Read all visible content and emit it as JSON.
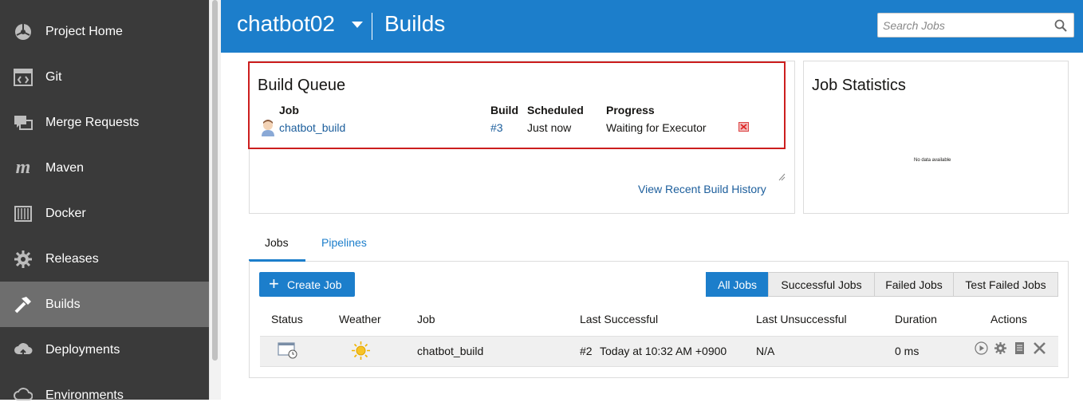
{
  "sidebar": {
    "items": [
      {
        "label": "Project Home",
        "icon": "project-home-icon"
      },
      {
        "label": "Git",
        "icon": "git-icon"
      },
      {
        "label": "Merge Requests",
        "icon": "merge-requests-icon"
      },
      {
        "label": "Maven",
        "icon": "maven-icon"
      },
      {
        "label": "Docker",
        "icon": "docker-icon"
      },
      {
        "label": "Releases",
        "icon": "releases-icon"
      },
      {
        "label": "Builds",
        "icon": "builds-icon",
        "active": true
      },
      {
        "label": "Deployments",
        "icon": "deployments-icon"
      },
      {
        "label": "Environments",
        "icon": "environments-icon"
      }
    ]
  },
  "header": {
    "project": "chatbot02",
    "title": "Builds",
    "search_placeholder": "Search Jobs"
  },
  "build_queue": {
    "title": "Build Queue",
    "columns": {
      "job": "Job",
      "build": "Build",
      "scheduled": "Scheduled",
      "progress": "Progress"
    },
    "row": {
      "job": "chatbot_build",
      "build": "#3",
      "scheduled": "Just now",
      "progress": "Waiting for Executor"
    },
    "view_history": "View Recent Build History"
  },
  "job_statistics": {
    "title": "Job Statistics",
    "empty_text": "No data available"
  },
  "tabs": {
    "jobs": "Jobs",
    "pipelines": "Pipelines"
  },
  "jobs": {
    "create_label": "Create Job",
    "filters": [
      "All Jobs",
      "Successful Jobs",
      "Failed Jobs",
      "Test Failed Jobs"
    ],
    "active_filter": "All Jobs",
    "columns": {
      "status": "Status",
      "weather": "Weather",
      "job": "Job",
      "last_successful": "Last Successful",
      "last_unsuccessful": "Last Unsuccessful",
      "duration": "Duration",
      "actions": "Actions"
    },
    "rows": [
      {
        "job": "chatbot_build",
        "last_successful_build": "#2",
        "last_successful_time": "Today at 10:32 AM +0900",
        "last_unsuccessful": "N/A",
        "duration": "0 ms"
      }
    ]
  },
  "colors": {
    "header_bg": "#1c7ecb",
    "sidebar_bg": "#3a3a3a",
    "sidebar_active": "#6e6e6e",
    "link": "#1c5e9c",
    "highlight": "#cc1e1e"
  }
}
